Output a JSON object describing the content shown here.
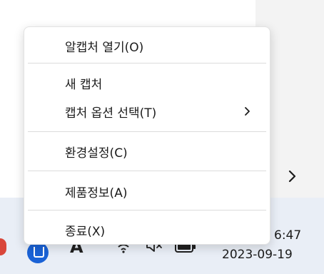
{
  "menu": {
    "items": [
      {
        "label": "알캡처 열기(O)"
      },
      {
        "label": "새 캡처"
      },
      {
        "label": "캡처 옵션 선택(T)"
      },
      {
        "label": "환경설정(C)"
      },
      {
        "label": "제품정보(A)"
      },
      {
        "label": "종료(X)"
      }
    ]
  },
  "taskbar": {
    "ime_indicator": "A",
    "time": "6:47",
    "date": "2023-09-19"
  },
  "icons": {
    "submenu": "chevron-right-icon",
    "overflow": "chevron-right-icon",
    "app": "alcapture-tray-icon",
    "wifi": "wifi-icon",
    "volume": "volume-muted-icon",
    "battery": "battery-icon"
  },
  "colors": {
    "taskbar_bg": "#e9eef6",
    "menu_bg": "#ffffff",
    "app_icon": "#1a62d6"
  }
}
